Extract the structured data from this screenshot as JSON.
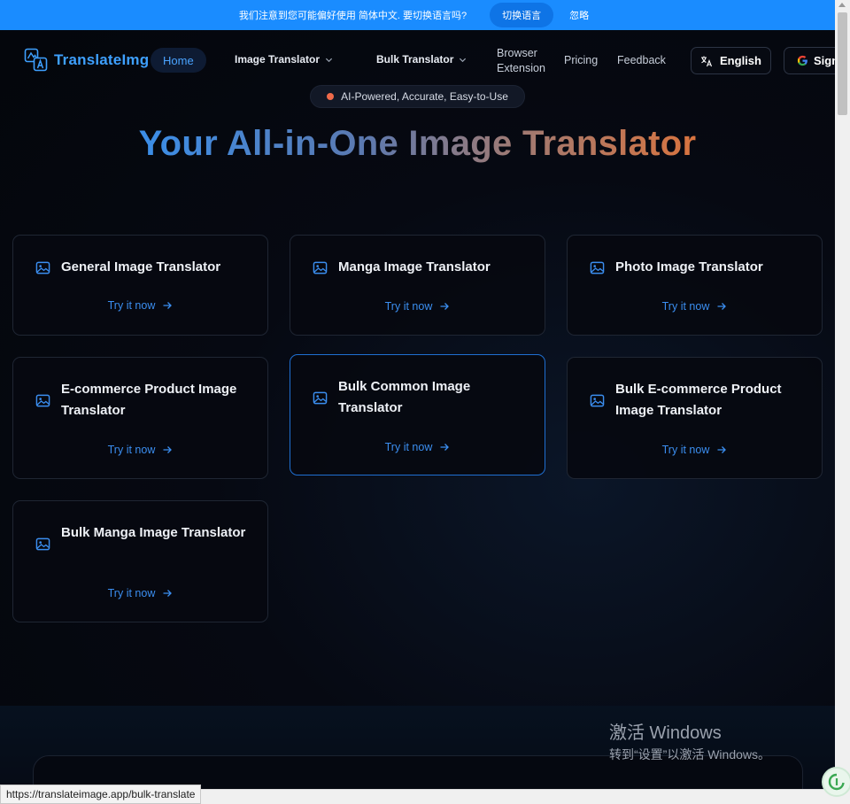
{
  "langbar": {
    "message": "我们注意到您可能偏好使用 简体中文. 要切换语言吗?",
    "switch_label": "切换语言",
    "ignore_label": "忽略"
  },
  "header": {
    "logo_text": "TranslateImg",
    "nav": {
      "home": "Home",
      "image_translator": "Image Translator",
      "bulk_translator": "Bulk Translator",
      "browser_extension_line1": "Browser",
      "browser_extension_line2": "Extension",
      "pricing": "Pricing",
      "feedback": "Feedback"
    },
    "language_button": "English",
    "sign_in_button": "Sign"
  },
  "hero": {
    "badge": "AI-Powered, Accurate, Easy-to-Use",
    "title": "Your All-in-One Image Translator"
  },
  "cards": [
    {
      "title": "General Image Translator",
      "cta": "Try it now"
    },
    {
      "title": "Manga Image Translator",
      "cta": "Try it now"
    },
    {
      "title": "Photo Image Translator",
      "cta": "Try it now"
    },
    {
      "title": "E-commerce Product Image Translator",
      "cta": "Try it now"
    },
    {
      "title": "Bulk Common Image Translator",
      "cta": "Try it now"
    },
    {
      "title": "Bulk E-commerce Product Image Translator",
      "cta": "Try it now"
    },
    {
      "title": "Bulk Manga Image Translator",
      "cta": "Try it now"
    }
  ],
  "windows_watermark": {
    "line1": "激活 Windows",
    "line2": "转到“设置”以激活 Windows。"
  },
  "status_url": "https://translateimage.app/bulk-translate",
  "colors": {
    "accent": "#1a8cff",
    "link": "#3b8ef0",
    "background": "#05070d"
  }
}
